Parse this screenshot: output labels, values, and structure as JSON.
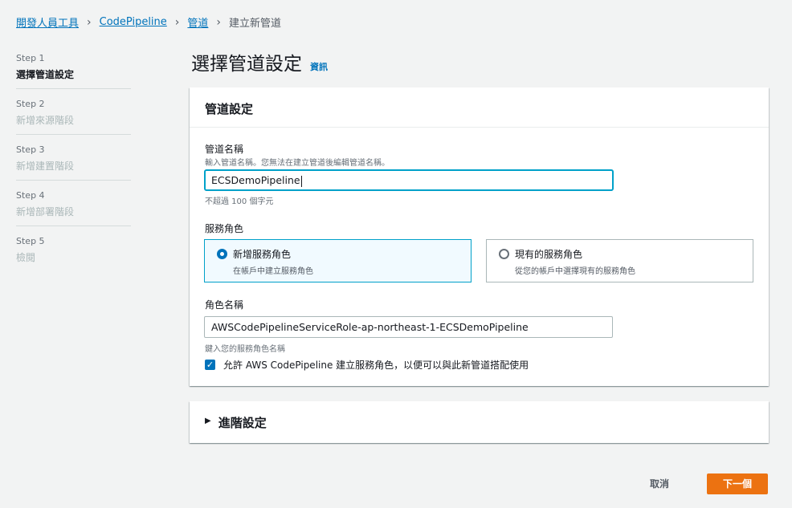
{
  "breadcrumb": {
    "items": [
      "開發人員工具",
      "CodePipeline",
      "管道"
    ],
    "current": "建立新管道"
  },
  "steps": [
    {
      "num": "Step 1",
      "name": "選擇管道設定",
      "active": true
    },
    {
      "num": "Step 2",
      "name": "新增來源階段",
      "active": false
    },
    {
      "num": "Step 3",
      "name": "新增建置階段",
      "active": false
    },
    {
      "num": "Step 4",
      "name": "新增部署階段",
      "active": false
    },
    {
      "num": "Step 5",
      "name": "檢閱",
      "active": false
    }
  ],
  "page": {
    "title": "選擇管道設定",
    "info_link": "資訊"
  },
  "panel": {
    "header": "管道設定",
    "pipeline_name": {
      "label": "管道名稱",
      "description": "輸入管道名稱。您無法在建立管道後編輯管道名稱。",
      "value": "ECSDemoPipeline",
      "constraint": "不超過 100 個字元"
    },
    "service_role": {
      "label": "服務角色",
      "options": [
        {
          "title": "新增服務角色",
          "desc": "在帳戶中建立服務角色",
          "selected": true
        },
        {
          "title": "現有的服務角色",
          "desc": "從您的帳戶中選擇現有的服務角色",
          "selected": false
        }
      ]
    },
    "role_name": {
      "label": "角色名稱",
      "value": "AWSCodePipelineServiceRole-ap-northeast-1-ECSDemoPipeline",
      "description": "鍵入您的服務角色名稱"
    },
    "checkbox": {
      "label": "允許 AWS CodePipeline 建立服務角色，以便可以與此新管道搭配使用",
      "checked": true
    }
  },
  "advanced": {
    "label": "進階設定"
  },
  "footer": {
    "cancel_label": "取消",
    "next_label": "下一個"
  },
  "colors": {
    "accent": "#0073bb",
    "primary_button": "#ec7211",
    "focus": "#00a1c9"
  }
}
